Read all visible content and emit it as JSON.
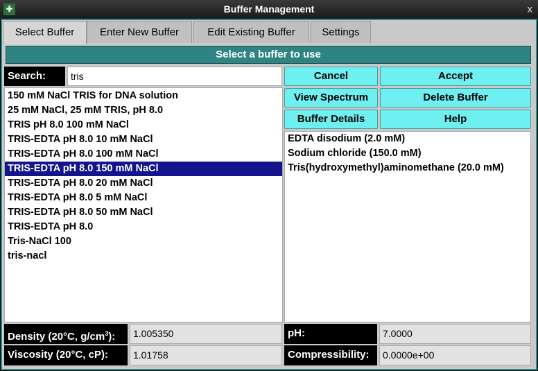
{
  "window": {
    "title": "Buffer Management",
    "close": "x"
  },
  "tabs": [
    {
      "label": "Select Buffer"
    },
    {
      "label": "Enter New Buffer"
    },
    {
      "label": "Edit Existing Buffer"
    },
    {
      "label": "Settings"
    }
  ],
  "banner": "Select a buffer to use",
  "search": {
    "label": "Search:",
    "value": "tris"
  },
  "buttons": {
    "cancel": "Cancel",
    "accept": "Accept",
    "view_spectrum": "View Spectrum",
    "delete": "Delete Buffer",
    "details": "Buffer Details",
    "help": "Help"
  },
  "buffers": [
    "150 mM NaCl TRIS for DNA solution",
    "25 mM NaCl, 25 mM TRIS, pH 8.0",
    "TRIS pH 8.0 100 mM NaCl",
    "TRIS-EDTA pH 8.0 10 mM NaCl",
    "TRIS-EDTA pH 8.0 100 mM NaCl",
    "TRIS-EDTA pH 8.0 150 mM NaCl",
    "TRIS-EDTA pH 8.0 20 mM NaCl",
    "TRIS-EDTA pH 8.0 5 mM NaCl",
    "TRIS-EDTA pH 8.0 50 mM NaCl",
    "TRIS-EDTA pH 8.0",
    "Tris-NaCl 100",
    "tris-nacl"
  ],
  "selected_index": 5,
  "components": [
    "EDTA disodium (2.0 mM)",
    "Sodium chloride (150.0 mM)",
    "Tris(hydroxymethyl)aminomethane (20.0 mM)"
  ],
  "properties": {
    "density_label": "Density (20°C, g/cm",
    "density_sup": "3",
    "density_suffix": "):",
    "density": "1.005350",
    "viscosity_label": "Viscosity (20°C, cP):",
    "viscosity": "1.01758",
    "ph_label": "pH:",
    "ph": "7.0000",
    "compress_label": "Compressibility:",
    "compressibility": "0.0000e+00"
  }
}
